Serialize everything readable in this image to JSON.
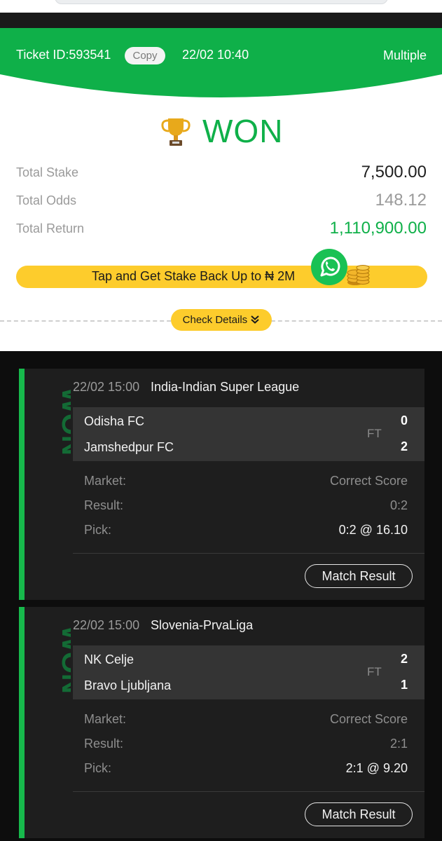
{
  "ticket": {
    "id_label": "Ticket ID:593541",
    "copy_label": "Copy",
    "datetime": "22/02 10:40",
    "type": "Multiple"
  },
  "status": {
    "label": "WON",
    "icon": "trophy-icon",
    "color": "#0fb049"
  },
  "summary": [
    {
      "label": "Total Stake",
      "value": "7,500.00",
      "color": "#1f1f1f"
    },
    {
      "label": "Total Odds",
      "value": "148.12",
      "color": "#9a9a9a"
    },
    {
      "label": "Total Return",
      "value": "1,110,900.00",
      "color": "#0fb049"
    }
  ],
  "promo": {
    "text": "Tap and Get Stake Back Up to ₦ 2M",
    "icons": [
      "whatsapp-icon",
      "coins-icon"
    ]
  },
  "check_details_label": "Check Details",
  "bets": [
    {
      "status": "WON",
      "time": "22/02 15:00",
      "league": "India-Indian Super League",
      "home": "Odisha FC",
      "away": "Jamshedpur FC",
      "home_score": "0",
      "away_score": "2",
      "period": "FT",
      "market_label": "Market:",
      "market": "Correct Score",
      "result_label": "Result:",
      "result": "0:2",
      "pick_label": "Pick:",
      "pick": "0:2 @ 16.10",
      "button": "Match Result"
    },
    {
      "status": "WON",
      "time": "22/02 15:00",
      "league": "Slovenia-PrvaLiga",
      "home": "NK Celje",
      "away": "Bravo Ljubljana",
      "home_score": "2",
      "away_score": "1",
      "period": "FT",
      "market_label": "Market:",
      "market": "Correct Score",
      "result_label": "Result:",
      "result": "2:1",
      "pick_label": "Pick:",
      "pick": "2:1 @ 9.20",
      "button": "Match Result"
    }
  ],
  "colors": {
    "green": "#0fb049",
    "yellow": "#fdcc2c",
    "dark_bg": "#0d0d0d",
    "card_bg": "#1e1e1e"
  }
}
